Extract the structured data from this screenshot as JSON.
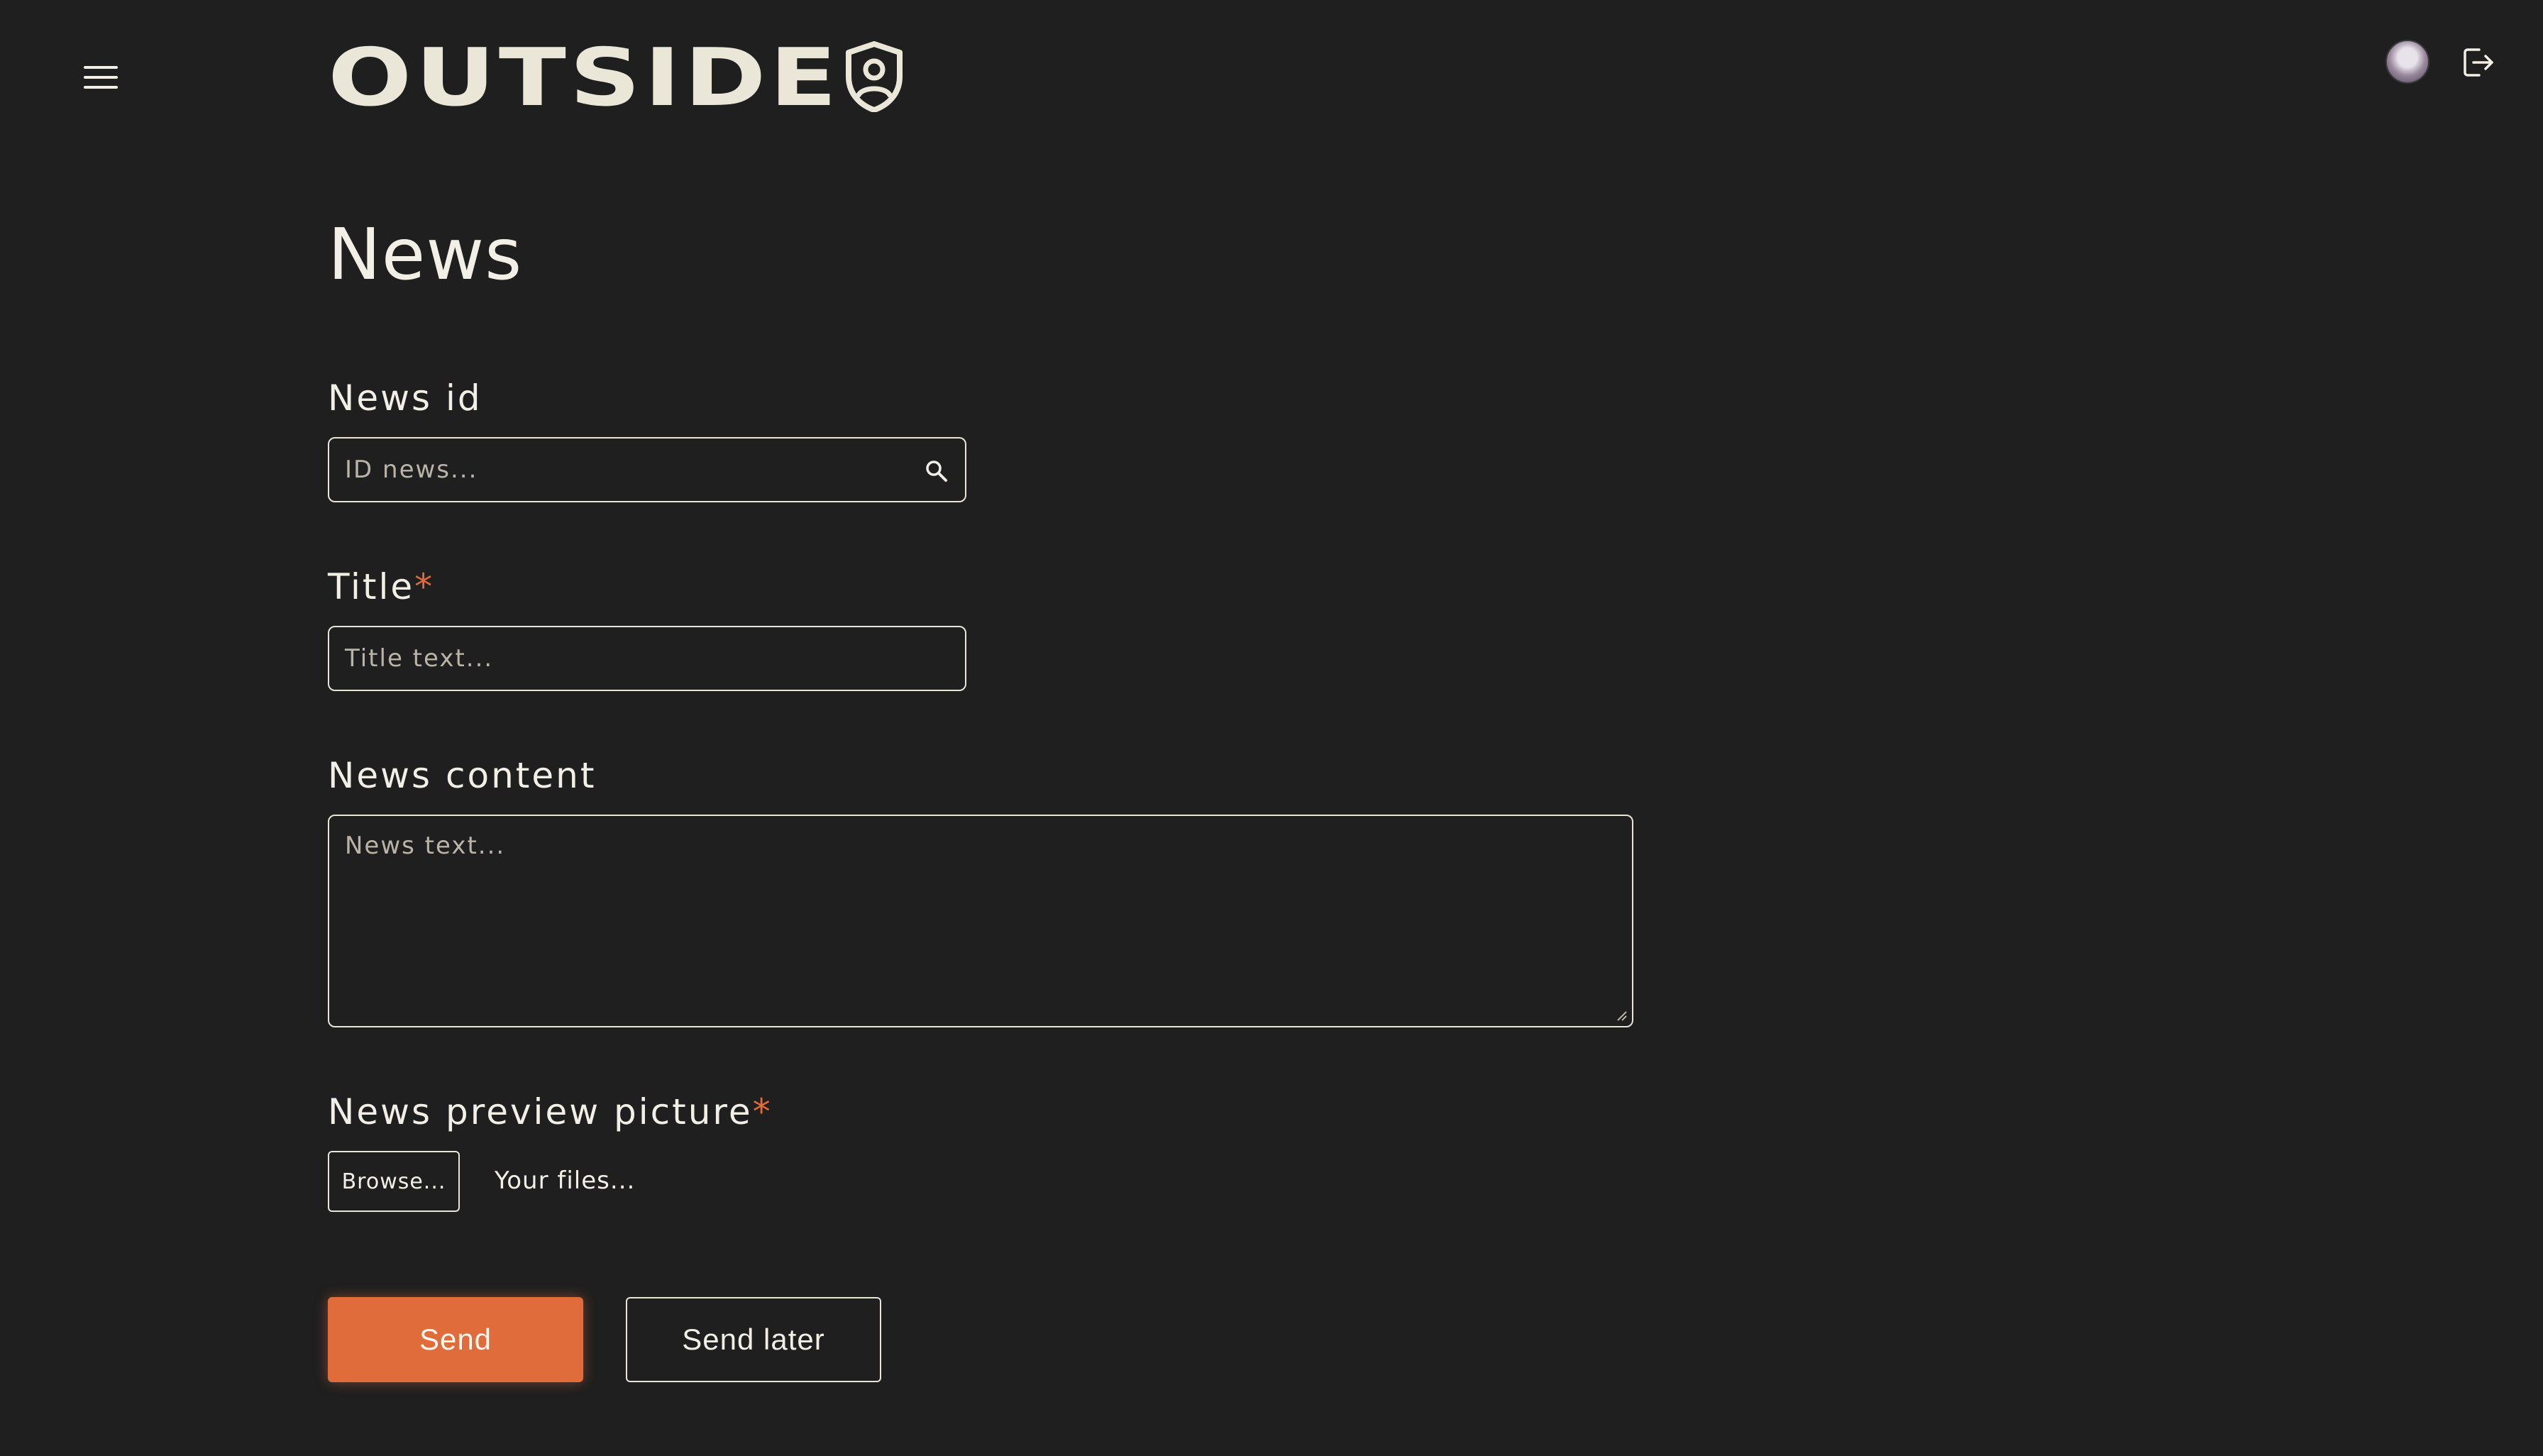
{
  "header": {
    "logo_text": "OUTSIDE",
    "menu_icon": "hamburger-menu-icon",
    "logo_icon": "shield-user-icon",
    "avatar_icon": "user-avatar",
    "logout_icon": "logout-icon"
  },
  "page": {
    "title": "News"
  },
  "form": {
    "news_id": {
      "label": "News id",
      "placeholder": "ID news...",
      "icon": "search-icon"
    },
    "title": {
      "label": "Title",
      "required_mark": "*",
      "placeholder": "Title text..."
    },
    "content": {
      "label": "News content",
      "placeholder": "News text..."
    },
    "preview": {
      "label": "News preview picture",
      "required_mark": "*",
      "browse_label": "Browse...",
      "files_text": "Your files..."
    },
    "actions": {
      "send_label": "Send",
      "send_later_label": "Send later"
    }
  },
  "colors": {
    "background": "#1f1f1f",
    "accent": "#e06c3c",
    "text": "#f2efe6"
  }
}
